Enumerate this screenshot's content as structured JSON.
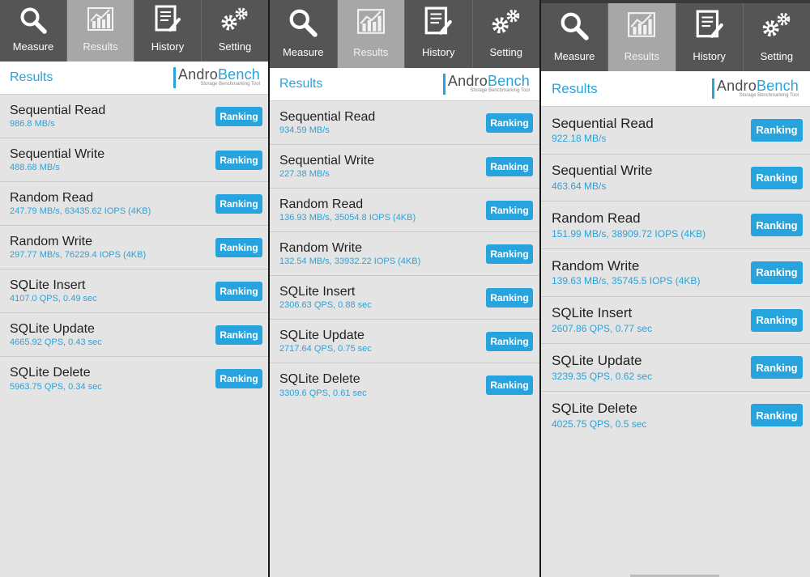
{
  "tabs": [
    "Measure",
    "Results",
    "History",
    "Setting"
  ],
  "header_title": "Results",
  "brand": {
    "andro": "Andro",
    "bench": "Bench",
    "tagline": "Storage Benchmarking Tool"
  },
  "ranking_label": "Ranking",
  "colors": {
    "accent": "#2aa3da",
    "nav_bg": "#555555",
    "nav_active": "#a7a7a7",
    "row_bg": "#e4e4e4",
    "button": "#27a4dd"
  },
  "icons": [
    "search-icon",
    "chart-icon",
    "document-edit-icon",
    "gears-icon"
  ],
  "panels": [
    {
      "rows": [
        {
          "name": "Sequential Read",
          "value": "986.8 MB/s"
        },
        {
          "name": "Sequential Write",
          "value": "488.68 MB/s"
        },
        {
          "name": "Random Read",
          "value": "247.79 MB/s, 63435.62 IOPS (4KB)"
        },
        {
          "name": "Random Write",
          "value": "297.77 MB/s, 76229.4 IOPS (4KB)"
        },
        {
          "name": "SQLite Insert",
          "value": "4107.0 QPS, 0.49 sec"
        },
        {
          "name": "SQLite Update",
          "value": "4665.92 QPS, 0.43 sec"
        },
        {
          "name": "SQLite Delete",
          "value": "5963.75 QPS, 0.34 sec"
        }
      ]
    },
    {
      "rows": [
        {
          "name": "Sequential Read",
          "value": "934.59 MB/s"
        },
        {
          "name": "Sequential Write",
          "value": "227.38 MB/s"
        },
        {
          "name": "Random Read",
          "value": "136.93 MB/s, 35054.8 IOPS (4KB)"
        },
        {
          "name": "Random Write",
          "value": "132.54 MB/s, 33932.22 IOPS (4KB)"
        },
        {
          "name": "SQLite Insert",
          "value": "2306.63 QPS, 0.88 sec"
        },
        {
          "name": "SQLite Update",
          "value": "2717.64 QPS, 0.75 sec"
        },
        {
          "name": "SQLite Delete",
          "value": "3309.6 QPS, 0.61 sec"
        }
      ]
    },
    {
      "rows": [
        {
          "name": "Sequential Read",
          "value": "922.18 MB/s"
        },
        {
          "name": "Sequential Write",
          "value": "463.64 MB/s"
        },
        {
          "name": "Random Read",
          "value": "151.99 MB/s, 38909.72 IOPS (4KB)"
        },
        {
          "name": "Random Write",
          "value": "139.63 MB/s, 35745.5 IOPS (4KB)"
        },
        {
          "name": "SQLite Insert",
          "value": "2607.86 QPS, 0.77 sec"
        },
        {
          "name": "SQLite Update",
          "value": "3239.35 QPS, 0.62 sec"
        },
        {
          "name": "SQLite Delete",
          "value": "4025.75 QPS, 0.5 sec"
        }
      ]
    }
  ]
}
